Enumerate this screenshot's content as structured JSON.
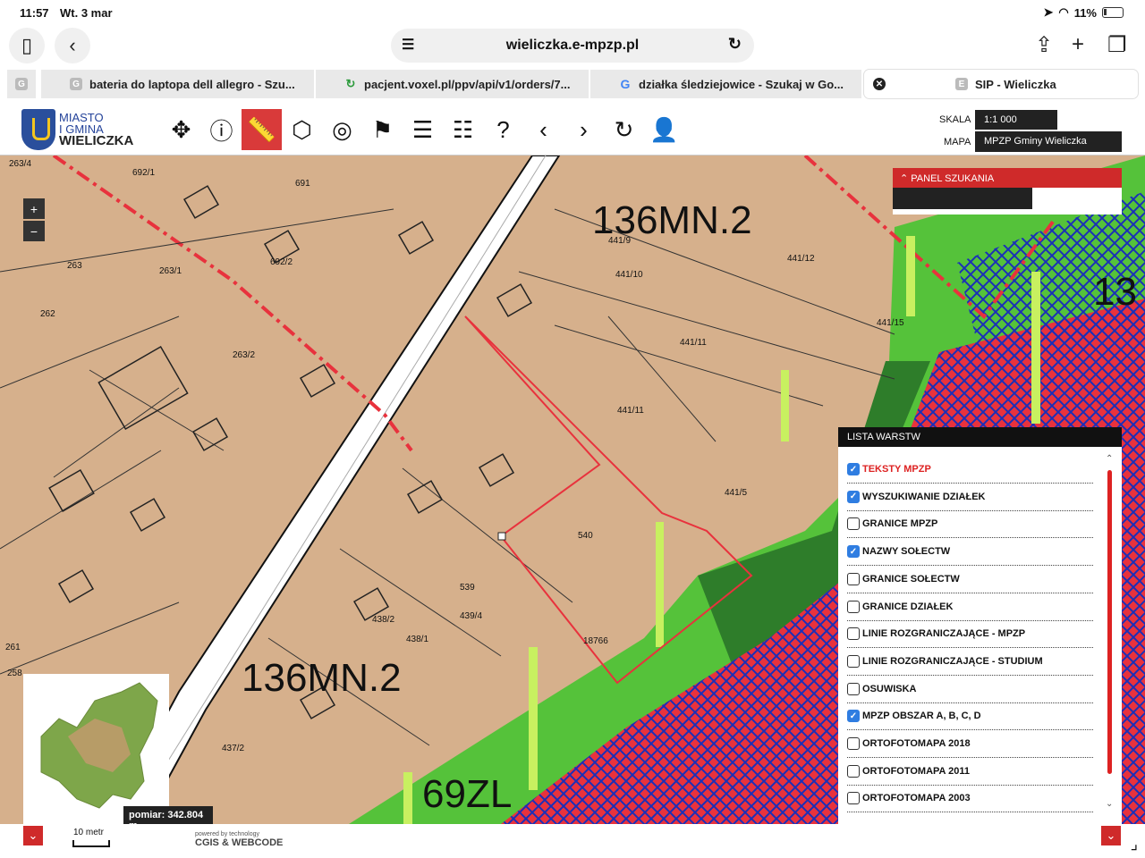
{
  "status": {
    "time": "11:57",
    "date": "Wt. 3 mar",
    "battery": "11%"
  },
  "browser": {
    "url": "wieliczka.e-mpzp.pl",
    "tabs": [
      {
        "label": "bateria do laptopa dell allegro - Szu...",
        "favicon": "G"
      },
      {
        "label": "pacjent.voxel.pl/ppv/api/v1/orders/7...",
        "favicon": "link-icon"
      },
      {
        "label": "działka śledziejowice - Szukaj w Go...",
        "favicon": "G"
      },
      {
        "label": "SIP - Wieliczka",
        "favicon": "E"
      }
    ]
  },
  "app": {
    "logo": {
      "line1": "MIASTO",
      "line2": "I GMINA",
      "line3": "WIELICZKA"
    },
    "scale_label": "SKALA",
    "scale_value": "1:1 000",
    "map_label": "MAPA",
    "map_value": "MPZP Gminy Wieliczka"
  },
  "map": {
    "labels": [
      "136MN.2",
      "136MN.2",
      "69ZL",
      "13"
    ],
    "parcels": [
      "263/4",
      "692/1",
      "691",
      "263",
      "263/1",
      "692/2",
      "262",
      "263/2",
      "441/9",
      "441/10",
      "441/12",
      "441/15",
      "441/11",
      "441/11",
      "441/5",
      "540",
      "539",
      "439/4",
      "438/1",
      "438/2",
      "18766",
      "261",
      "258",
      "437/2"
    ],
    "zoom_in": "+",
    "zoom_out": "−",
    "measure": "pomiar: 342.804 m"
  },
  "search_panel": {
    "title": "PANEL SZUKANIA"
  },
  "layers": {
    "title": "LISTA WARSTW",
    "items": [
      {
        "label": "TEKSTY MPZP",
        "checked": true
      },
      {
        "label": "WYSZUKIWANIE DZIAŁEK",
        "checked": true
      },
      {
        "label": "GRANICE MPZP",
        "checked": false
      },
      {
        "label": "NAZWY SOŁECTW",
        "checked": true
      },
      {
        "label": "GRANICE SOŁECTW",
        "checked": false
      },
      {
        "label": "GRANICE DZIAŁEK",
        "checked": false
      },
      {
        "label": "LINIE ROZGRANICZAJĄCE - MPZP",
        "checked": false
      },
      {
        "label": "LINIE ROZGRANICZAJĄCE - STUDIUM",
        "checked": false
      },
      {
        "label": "OSUWISKA",
        "checked": false
      },
      {
        "label": "MPZP OBSZAR A, B, C, D",
        "checked": true
      },
      {
        "label": "ORTOFOTOMAPA 2018",
        "checked": false
      },
      {
        "label": "ORTOFOTOMAPA 2011",
        "checked": false
      },
      {
        "label": "ORTOFOTOMAPA 2003",
        "checked": false
      }
    ]
  },
  "footer": {
    "scalebar": "10 metr",
    "powered": "powered by technology",
    "brand": "CGIS & WEBCODE"
  },
  "colors": {
    "accent": "#cf2a2a",
    "zone_mn": "#d6b08c",
    "zone_zl": "#55c23a",
    "zone_red": "#e8323d",
    "hatch": "#1a2fb8"
  }
}
